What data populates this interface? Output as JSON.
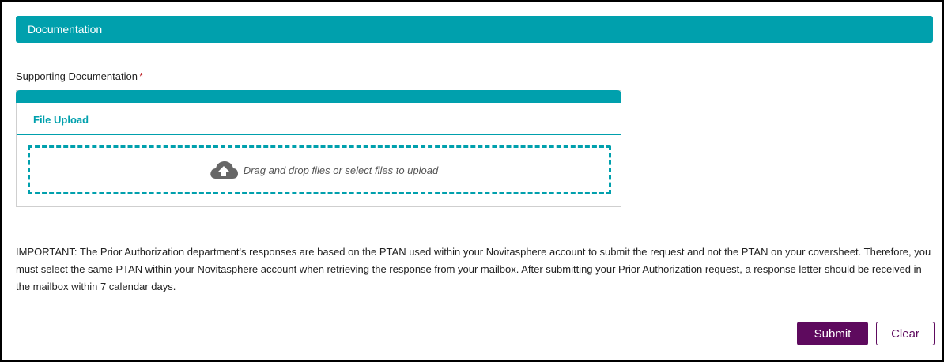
{
  "section": {
    "title": "Documentation"
  },
  "supporting_docs": {
    "label": "Supporting Documentation",
    "required_marker": "*"
  },
  "upload": {
    "tab_label": "File Upload",
    "drop_text": "Drag and drop files or select files to upload",
    "icon": "cloud-upload-icon"
  },
  "notice": {
    "text": "IMPORTANT: The Prior Authorization department's responses are based on the PTAN used within your Novitasphere account to submit the request and not the PTAN on your coversheet. Therefore, you must select the same PTAN within your Novitasphere account when retrieving the response from your mailbox. After submitting your Prior Authorization request, a response letter should be received in the mailbox within 7 calendar days."
  },
  "actions": {
    "submit_label": "Submit",
    "clear_label": "Clear"
  },
  "colors": {
    "accent": "#00a0ad",
    "primary_button": "#5e0a5e",
    "required": "#c0282d"
  }
}
